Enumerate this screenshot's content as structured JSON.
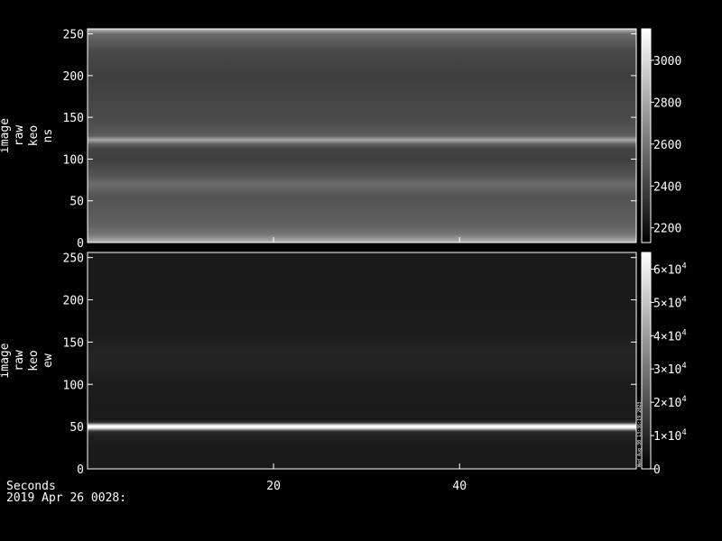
{
  "footer": {
    "xlabel": "Seconds",
    "date": "2019 Apr 26 0028:"
  },
  "chart_data": [
    {
      "type": "heatmap",
      "ylabel": [
        "image",
        "raw",
        "keo",
        "ns"
      ],
      "ylim": [
        0,
        256
      ],
      "y_ticks": [
        "0",
        "50",
        "100",
        "150",
        "200",
        "250"
      ],
      "y_tick_values": [
        0,
        50,
        100,
        150,
        200,
        250
      ],
      "xlim": [
        0,
        59
      ],
      "colorbar": {
        "range": [
          2130,
          3150
        ],
        "ticks": [
          "2200",
          "2400",
          "2600",
          "2800",
          "3000"
        ],
        "tick_values": [
          2200,
          2400,
          2600,
          2800,
          3000
        ]
      },
      "profile_rows": [
        0,
        5,
        10,
        20,
        40,
        55,
        70,
        80,
        90,
        100,
        112,
        118,
        123,
        128,
        135,
        150,
        175,
        200,
        230,
        250,
        256
      ],
      "profile_values": [
        2850,
        2720,
        2600,
        2520,
        2480,
        2460,
        2560,
        2470,
        2420,
        2380,
        2400,
        2520,
        2800,
        2500,
        2460,
        2420,
        2400,
        2380,
        2420,
        2560,
        2900
      ],
      "colormap": "grayscale"
    },
    {
      "type": "heatmap",
      "ylabel": [
        "image",
        "raw",
        "keo",
        "ew"
      ],
      "ylim": [
        0,
        256
      ],
      "y_ticks": [
        "0",
        "50",
        "100",
        "150",
        "200",
        "250"
      ],
      "y_tick_values": [
        0,
        50,
        100,
        150,
        200,
        250
      ],
      "xlim": [
        0,
        59
      ],
      "x_ticks": [
        "20",
        "40"
      ],
      "x_tick_values": [
        20,
        40
      ],
      "colorbar": {
        "range": [
          0,
          65000
        ],
        "ticks": [
          "0",
          "1x10^4",
          "2x10^4",
          "3x10^4",
          "4x10^4",
          "5x10^4",
          "6x10^4"
        ],
        "tick_values": [
          0,
          10000,
          20000,
          30000,
          40000,
          50000,
          60000
        ],
        "vertical_note": "Wed_Aug_30_13:36:19_2023"
      },
      "profile_rows": [
        0,
        20,
        30,
        38,
        43,
        45,
        47,
        49,
        51,
        53,
        55,
        58,
        70,
        100,
        120,
        140,
        160,
        200,
        256
      ],
      "profile_values": [
        6500,
        6500,
        6800,
        7800,
        10000,
        18000,
        45000,
        65000,
        65000,
        40000,
        12000,
        7000,
        6500,
        7200,
        8800,
        9200,
        7200,
        6500,
        6500
      ],
      "colormap": "grayscale"
    }
  ]
}
